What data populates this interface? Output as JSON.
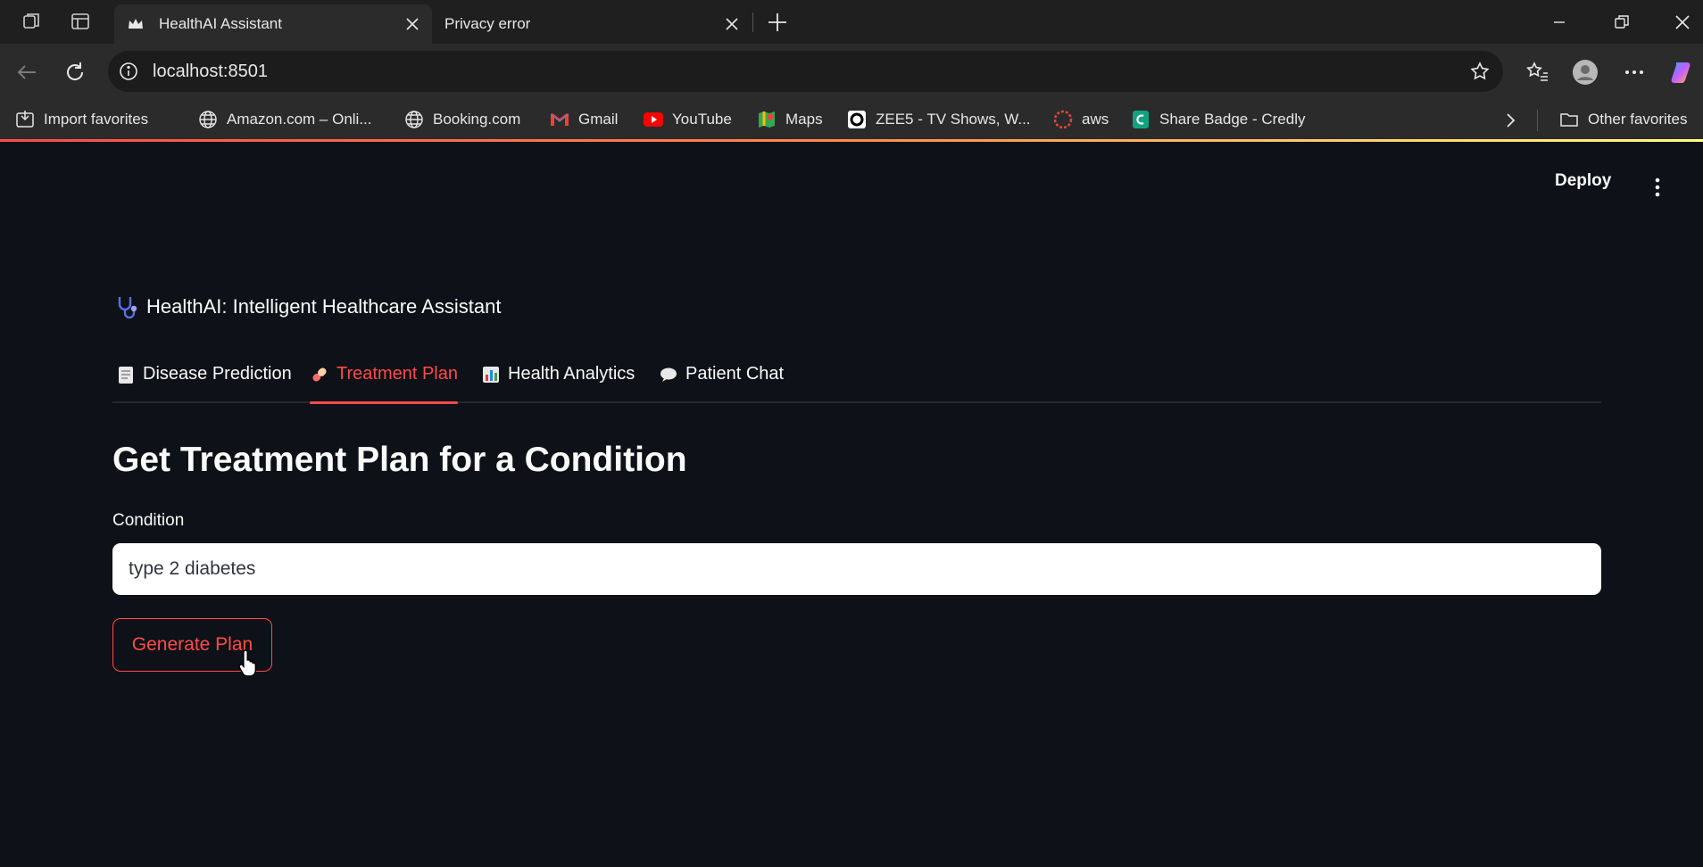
{
  "browser": {
    "tabs": [
      {
        "title": "HealthAI Assistant",
        "active": true
      },
      {
        "title": "Privacy error",
        "active": false
      }
    ],
    "address": "localhost:8501",
    "bookmarks": [
      {
        "label": "Import favorites",
        "icon": "import-icon"
      },
      {
        "label": "Amazon.com – Onli...",
        "icon": "globe-icon"
      },
      {
        "label": "Booking.com",
        "icon": "globe-icon"
      },
      {
        "label": "Gmail",
        "icon": "gmail-icon"
      },
      {
        "label": "YouTube",
        "icon": "youtube-icon"
      },
      {
        "label": "Maps",
        "icon": "maps-icon"
      },
      {
        "label": "ZEE5 - TV Shows, W...",
        "icon": "zee5-icon"
      },
      {
        "label": "aws",
        "icon": "aws-icon"
      },
      {
        "label": "Share Badge - Credly",
        "icon": "credly-icon"
      }
    ],
    "other_favorites": "Other favorites"
  },
  "app": {
    "deploy_label": "Deploy",
    "title": "HealthAI: Intelligent Healthcare Assistant",
    "tabs": [
      {
        "label": "Disease Prediction",
        "icon": "clipboard-icon",
        "active": false
      },
      {
        "label": "Treatment Plan",
        "icon": "pill-icon",
        "active": true
      },
      {
        "label": "Health Analytics",
        "icon": "bar-chart-icon",
        "active": false
      },
      {
        "label": "Patient Chat",
        "icon": "speech-bubble-icon",
        "active": false
      }
    ],
    "heading": "Get Treatment Plan for a Condition",
    "condition_label": "Condition",
    "condition_value": "type 2 diabetes",
    "generate_button": "Generate Plan"
  },
  "colors": {
    "accent": "#ff4b4b",
    "background": "#0e1117",
    "chrome": "#2b2b2b"
  }
}
